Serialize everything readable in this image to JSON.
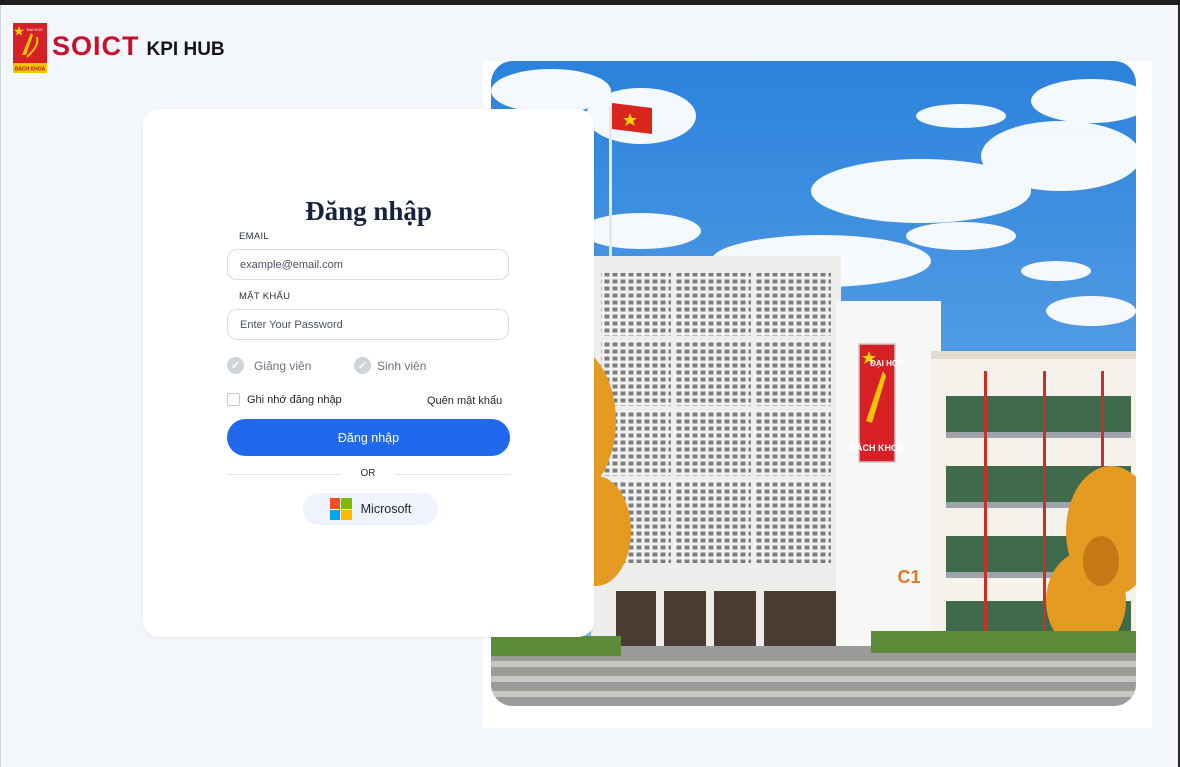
{
  "header": {
    "brand_name": "SOICT",
    "brand_suffix": "KPI HUB",
    "logo_text_top": "ĐẠI HỌC",
    "logo_text_bottom": "BÁCH KHOA"
  },
  "login": {
    "title": "Đăng nhập",
    "email_label": "EMAIL",
    "email_placeholder": "example@email.com",
    "password_label": "MẬT KHẨU",
    "password_placeholder": "Enter Your Password",
    "roles": [
      {
        "label": "Giảng viên"
      },
      {
        "label": "Sinh viên"
      }
    ],
    "remember_label": "Ghi nhớ đăng nhập",
    "forgot_label": "Quên mật khẩu",
    "submit_label": "Đăng nhập",
    "divider_text": "OR",
    "microsoft_label": "Microsoft"
  },
  "photo": {
    "building_sign_top": "ĐẠI HỌC",
    "building_sign_bottom": "BÁCH KHOA",
    "building_code": "C1"
  },
  "colors": {
    "primary": "#2169ec",
    "brand_red": "#c8102e",
    "background": "#f3f6fb"
  },
  "icons": [
    "check-circle-icon",
    "checkbox-icon",
    "microsoft-logo-icon"
  ]
}
